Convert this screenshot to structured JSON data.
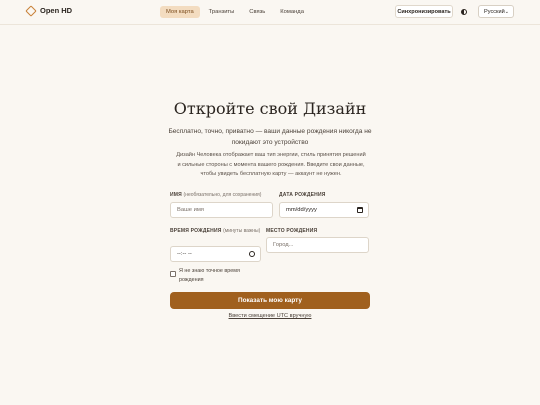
{
  "app": {
    "name": "Open HD"
  },
  "nav": {
    "items": [
      "Моя карта",
      "Транзиты",
      "Связь",
      "Команда"
    ]
  },
  "header": {
    "sync_label": "Синхронизировать",
    "language": "Русский"
  },
  "hero": {
    "title": "Откройте свой Дизайн",
    "subtitle": "Бесплатно, точно, приватно — ваши данные рождения никогда не покидают это устройство",
    "description": "Дизайн Человека отображает ваш тип энергии, стиль принятия решений и сильные стороны с момента вашего рождения. Введите свои данные, чтобы увидеть бесплатную карту — аккаунт не нужен."
  },
  "form": {
    "name_label": "ИМЯ",
    "name_hint": "(необязательно, для сохранения)",
    "name_placeholder": "Ваше имя",
    "date_label": "ДАТА РОЖДЕНИЯ",
    "date_value": "mm/dd/yyyy",
    "time_label": "ВРЕМЯ РОЖДЕНИЯ",
    "time_hint": "(минуты важны)",
    "time_value": "--:-- --",
    "place_label": "МЕСТО РОЖДЕНИЯ",
    "place_placeholder": "Город...",
    "unknown_time_label": "Я не знаю точное время рождения",
    "submit_label": "Показать мою карту",
    "utc_link": "Ввести смещение UTC вручную"
  },
  "colors": {
    "accent": "#a0601e",
    "active_tab_bg": "#f3dcc0",
    "background": "#faf7f2"
  },
  "icons": [
    "diamond-logo-icon",
    "theme-toggle-icon",
    "chevron-down-icon",
    "calendar-icon",
    "clock-icon"
  ]
}
